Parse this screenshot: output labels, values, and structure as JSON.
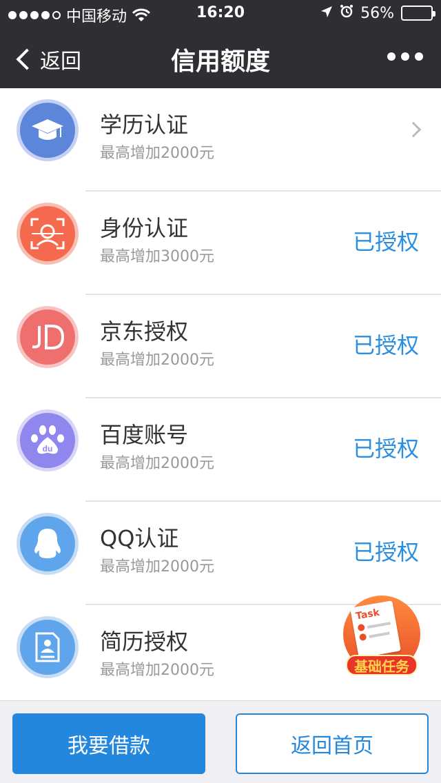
{
  "status_bar": {
    "carrier": "中国移动",
    "time": "16:20",
    "battery": "56%",
    "battery_level": 0.56,
    "signal_bars_filled": 4,
    "signal_bars_total": 5
  },
  "nav": {
    "back_label": "返回",
    "title": "信用额度",
    "more_icon": "more-icon"
  },
  "items": [
    {
      "name": "学历认证",
      "sub": "最高增加2000元",
      "status": "",
      "icon": "graduation-cap-icon",
      "ring": "#c5d1f2",
      "bg": "#5b86d9"
    },
    {
      "name": "身份认证",
      "sub": "最高增加3000元",
      "status": "已授权",
      "icon": "face-scan-icon",
      "ring": "#f7c0b4",
      "bg": "#f56a4f"
    },
    {
      "name": "京东授权",
      "sub": "最高增加2000元",
      "status": "已授权",
      "icon": "jd-logo-icon",
      "ring": "#f7c3c3",
      "bg": "#ef6e6e"
    },
    {
      "name": "百度账号",
      "sub": "最高增加2000元",
      "status": "已授权",
      "icon": "baidu-paw-icon",
      "ring": "#d9d5f6",
      "bg": "#8f86ee"
    },
    {
      "name": "QQ认证",
      "sub": "最高增加2000元",
      "status": "已授权",
      "icon": "qq-penguin-icon",
      "ring": "#c7ddf6",
      "bg": "#5fa5ec"
    },
    {
      "name": "简历授权",
      "sub": "最高增加2000元",
      "status": "",
      "icon": "resume-icon",
      "ring": "#c7ddf6",
      "bg": "#5fa5ec"
    }
  ],
  "task_badge": {
    "paper_text": "Task",
    "label": "基础任务"
  },
  "buttons": {
    "borrow": "我要借款",
    "home": "返回首页"
  }
}
